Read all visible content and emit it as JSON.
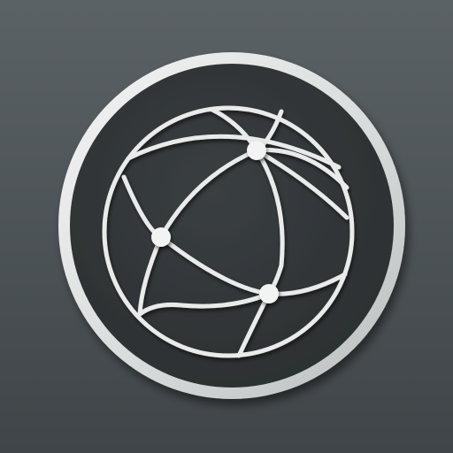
{
  "icon": {
    "name": "globe-network-icon",
    "colors": {
      "background_top": "#5b6266",
      "background_bottom": "#3f4548",
      "badge_face": "#313639",
      "badge_ring": "#e2e4e4",
      "globe_lines": "#e9ebeb",
      "node": "#f2f3f3"
    }
  }
}
